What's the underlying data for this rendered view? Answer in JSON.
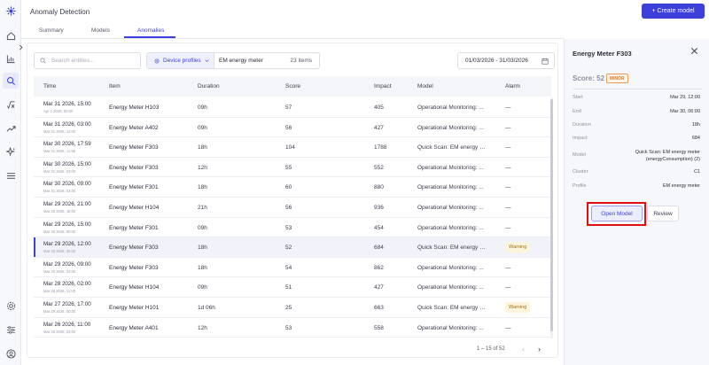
{
  "app": {
    "title": "Anomaly Detection",
    "create_label": "+ Create model"
  },
  "tabs": [
    {
      "label": "Summary"
    },
    {
      "label": "Models"
    },
    {
      "label": "Anomalies",
      "active": true
    }
  ],
  "filters": {
    "search_placeholder": "Search entities...",
    "device_profiles_label": "Device profiles",
    "profile_value": "EM energy meter",
    "items_count": "23 items",
    "date_range": "01/03/2026 - 31/03/2026"
  },
  "table": {
    "headers": [
      "Time",
      "Item",
      "Duration",
      "Score",
      "Impact",
      "Model",
      "Alarm"
    ],
    "rows": [
      {
        "time": "Mar 31 2026, 15:00",
        "time2": "Apr 1 2026, 00:00",
        "item": "Energy Meter H103",
        "duration": "09h",
        "score": "57",
        "impact": "405",
        "model": "Operational Monitoring: ...",
        "alarm": "—"
      },
      {
        "time": "Mar 31 2026, 03:00",
        "time2": "Mar 31 2026, 12:00",
        "item": "Energy Meter A402",
        "duration": "09h",
        "score": "56",
        "impact": "427",
        "model": "Operational Monitoring: ...",
        "alarm": "—"
      },
      {
        "time": "Mar 30 2026, 17:59",
        "time2": "Mar 31 2026, 11:59",
        "item": "Energy Meter F303",
        "duration": "18h",
        "score": "104",
        "impact": "1788",
        "model": "Quick Scan: EM energy me...",
        "alarm": "—"
      },
      {
        "time": "Mar 30 2026, 15:00",
        "time2": "Mar 31 2026, 03:00",
        "item": "Energy Meter F303",
        "duration": "12h",
        "score": "55",
        "impact": "552",
        "model": "Operational Monitoring: ...",
        "alarm": "—"
      },
      {
        "time": "Mar 30 2026, 09:00",
        "time2": "Mar 31 2026, 03:00",
        "item": "Energy Meter F301",
        "duration": "18h",
        "score": "60",
        "impact": "880",
        "model": "Operational Monitoring: ...",
        "alarm": "—"
      },
      {
        "time": "Mar 29 2026, 21:00",
        "time2": "Mar 30 2026, 18:00",
        "item": "Energy Meter H104",
        "duration": "21h",
        "score": "56",
        "impact": "936",
        "model": "Operational Monitoring: ...",
        "alarm": "—"
      },
      {
        "time": "Mar 29 2026, 15:00",
        "time2": "Mar 30 2026, 00:00",
        "item": "Energy Meter F301",
        "duration": "09h",
        "score": "53",
        "impact": "454",
        "model": "Operational Monitoring: ...",
        "alarm": "—"
      },
      {
        "time": "Mar 29 2026, 12:00",
        "time2": "Mar 30 2026, 06:00",
        "item": "Energy Meter F303",
        "duration": "18h",
        "score": "52",
        "impact": "684",
        "model": "Quick Scan: EM energy me...",
        "alarm": "Warning",
        "selected": true
      },
      {
        "time": "Mar 29 2026, 09:00",
        "time2": "Mar 30 2026, 03:00",
        "item": "Energy Meter F303",
        "duration": "18h",
        "score": "54",
        "impact": "862",
        "model": "Operational Monitoring: ...",
        "alarm": "—"
      },
      {
        "time": "Mar 28 2026, 02:00",
        "time2": "Mar 28 2026, 11:00",
        "item": "Energy Meter H104",
        "duration": "09h",
        "score": "51",
        "impact": "427",
        "model": "Operational Monitoring: ...",
        "alarm": "—"
      },
      {
        "time": "Mar 27 2026, 17:00",
        "time2": "Mar 29 2026, 00:00",
        "item": "Energy Meter H101",
        "duration": "1d 06h",
        "score": "25",
        "impact": "663",
        "model": "Quick Scan: EM energy me...",
        "alarm": "Warning"
      },
      {
        "time": "Mar 26 2026, 11:00",
        "time2": "Mar 26 2026, 23:00",
        "item": "Energy Meter A401",
        "duration": "12h",
        "score": "53",
        "impact": "558",
        "model": "Operational Monitoring: ...",
        "alarm": "—"
      }
    ]
  },
  "pagination": {
    "label": "1 – 15 of 52"
  },
  "panel": {
    "title": "Energy Meter F303",
    "score_label": "Score: 52",
    "severity": "MINOR",
    "fields": [
      {
        "label": "Start",
        "value": "Mar 29, 12:00"
      },
      {
        "label": "End",
        "value": "Mar 30, 06:00"
      },
      {
        "label": "Duration",
        "value": "18h"
      },
      {
        "label": "Impact",
        "value": "684"
      },
      {
        "label": "Model",
        "value": "Quick Scan: EM energy meter (energyConsumption) (2)"
      },
      {
        "label": "Cluster",
        "value": "C1"
      },
      {
        "label": "Profile",
        "value": "EM energy meter"
      }
    ],
    "open_label": "Open Model",
    "review_label": "Review"
  },
  "colors": {
    "accent": "#3d3fd9",
    "highlight": "#e01010",
    "warning_bg": "#fdf4dc"
  },
  "rail_icons": [
    "logo-icon",
    "home-icon",
    "chart-icon",
    "search-icon",
    "function-icon",
    "trend-icon",
    "sparkle-icon",
    "menu-icon",
    "settings-icon",
    "sliders-icon",
    "user-icon"
  ]
}
